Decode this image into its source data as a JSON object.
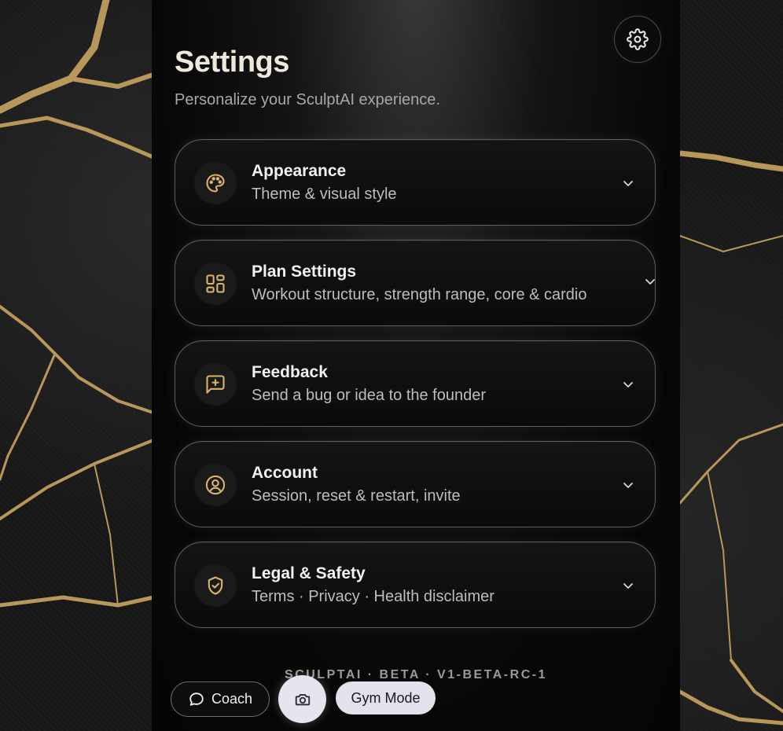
{
  "header": {
    "title": "Settings",
    "subtitle": "Personalize your SculptAI experience."
  },
  "sections": [
    {
      "title": "Appearance",
      "description": "Theme & visual style",
      "icon": "palette-icon"
    },
    {
      "title": "Plan Settings",
      "description": "Workout structure, strength range, core & cardio",
      "icon": "layout-grid-icon"
    },
    {
      "title": "Feedback",
      "description": "Send a bug or idea to the founder",
      "icon": "message-plus-icon"
    },
    {
      "title": "Account",
      "description": "Session, reset & restart, invite",
      "icon": "user-circle-icon"
    },
    {
      "title": "Legal & Safety",
      "description": "Terms · Privacy · Health disclaimer",
      "icon": "shield-check-icon"
    }
  ],
  "footer": {
    "version": "SCULPTAI · BETA · V1-BETA-RC-1"
  },
  "bottom_bar": {
    "coach_label": "Coach",
    "gym_mode_label": "Gym Mode"
  },
  "colors": {
    "accent_gold": "#d9b36a",
    "card_border": "#5d5d60",
    "panel_bg": "#070707"
  }
}
